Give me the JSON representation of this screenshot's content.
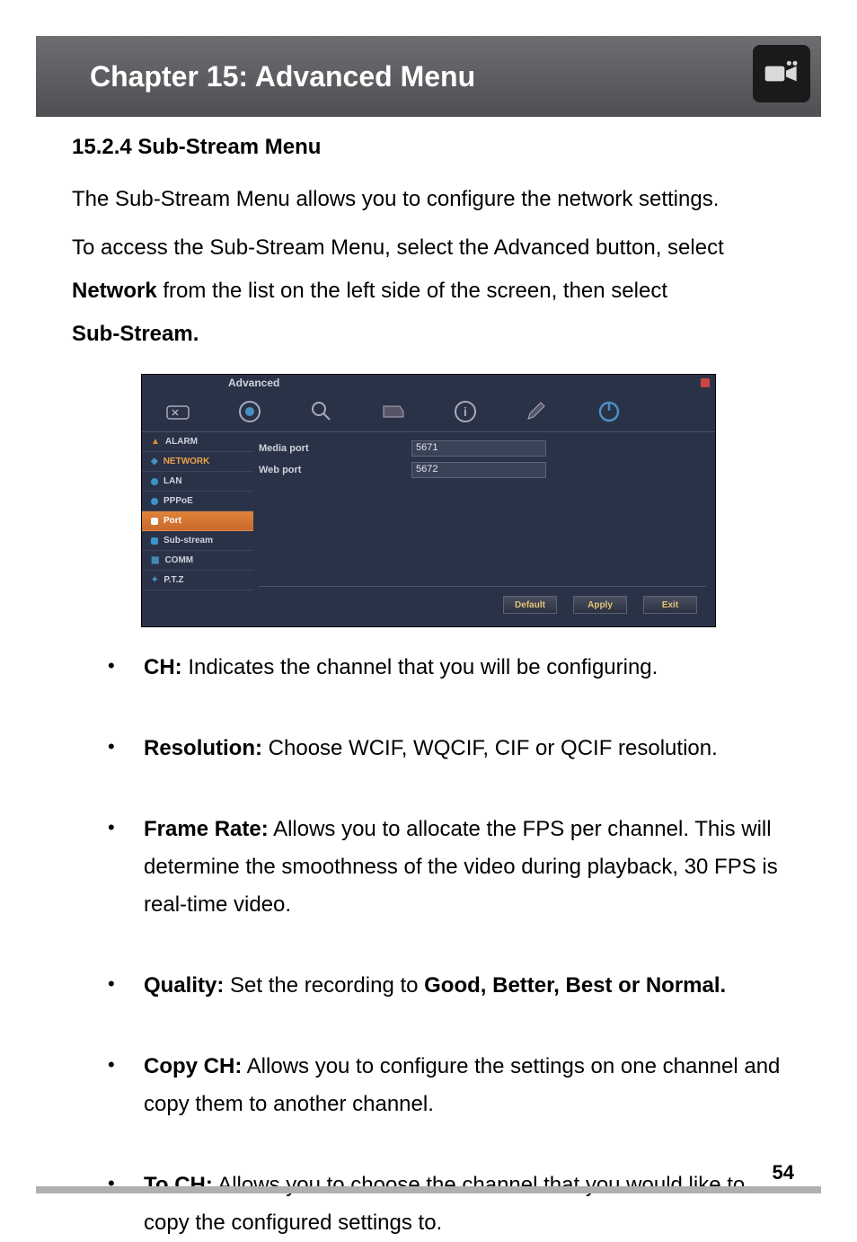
{
  "header": {
    "chapter_title": "Chapter 15: Advanced Menu",
    "icon": "video-camera-icon"
  },
  "section": {
    "heading": "15.2.4 Sub-Stream Menu",
    "para1": "The Sub-Stream Menu allows you to configure the network settings.",
    "para2_pre": "To access the Sub-Stream Menu, select the Advanced button, select ",
    "para2_bold1": "Network",
    "para2_mid": " from the list on the left side of the screen, then select ",
    "para2_bold2": "Sub-Stream."
  },
  "screenshot": {
    "title": "Advanced",
    "toolbar_icons": [
      "tools-icon",
      "record-icon",
      "search-icon",
      "hdd-icon",
      "info-icon",
      "brush-icon",
      "power-icon"
    ],
    "sidebar": {
      "alarm": "ALARM",
      "network": "NETWORK",
      "lan": "LAN",
      "pppoe": "PPPoE",
      "port": "Port",
      "substream": "Sub-stream",
      "comm": "COMM",
      "ptz": "P.T.Z"
    },
    "fields": {
      "media_port_label": "Media port",
      "media_port_value": "5671",
      "web_port_label": "Web port",
      "web_port_value": "5672"
    },
    "buttons": {
      "default": "Default",
      "apply": "Apply",
      "exit": "Exit"
    }
  },
  "bullets": {
    "ch_label": "CH:",
    "ch_text": " Indicates the channel that you will be configuring.",
    "res_label": "Resolution:",
    "res_text": " Choose WCIF, WQCIF, CIF or QCIF resolution.",
    "fr_label": "Frame Rate:",
    "fr_text": " Allows you to allocate the FPS per channel. This will determine the smoothness of the video during playback, 30 FPS is real-time video.",
    "q_label": "Quality:",
    "q_text_pre": " Set the recording to ",
    "q_text_bold": "Good, Better, Best or Normal.",
    "copy_label": "Copy CH:",
    "copy_text": " Allows you to configure the settings on one channel and copy them to another channel.",
    "to_label": "To CH:",
    "to_text": " Allows you to choose the channel that you would like to copy the configured settings to."
  },
  "page_number": "54"
}
